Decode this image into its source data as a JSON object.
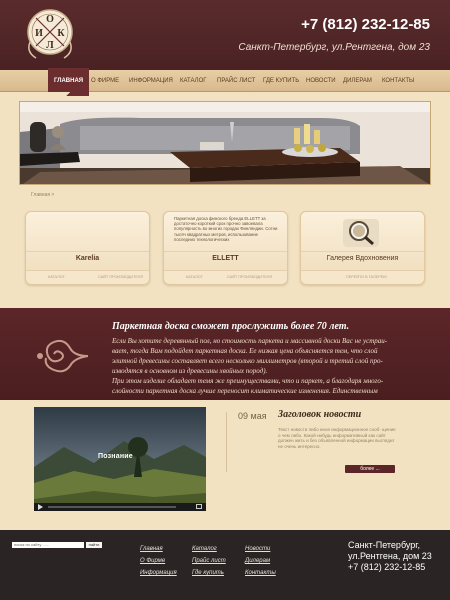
{
  "header": {
    "logo_letters": [
      "О",
      "И",
      "К",
      "Л"
    ],
    "phone": "+7 (812) 232-12-85",
    "address": "Санкт-Петербург, ул.Рентгена, дом 23"
  },
  "nav": {
    "items": [
      "Главная",
      "О фирме",
      "Информация",
      "Каталог",
      "Прайс лист",
      "Где купить",
      "Новости",
      "Дилерам",
      "Контакты"
    ]
  },
  "breadcrumb": "Главная  >",
  "cards": [
    {
      "title": "Karelia",
      "actions": [
        "Каталог",
        "Сайт производителя"
      ]
    },
    {
      "title": "ELLETT",
      "desc": "Паркетная доска финского бренда ELLETT за достаточно короткий срок прочно завоевала популярность во многих городах Финляндии. Сотни тысяч квадратных метров, использование последних технологических",
      "actions": [
        "Каталог",
        "Сайт производителя"
      ]
    },
    {
      "title": "Галерея Вдохновения",
      "actions": [
        "Перейти в галерею"
      ]
    }
  ],
  "quote": {
    "title": "Паркетная доска сможет прослужить более 70 лет.",
    "lines": [
      "Если Вы хотите деревянный пол, но стоимость паркета и массивной доски Вас не устраи-",
      "вает, тогда Вам подойдет паркетная доска. Ее низкая цена объясняется тем, что слой",
      "элитной древесины составляет всего несколько миллиметров (второй и третий слой про-",
      "изводятся в основном из древесины хвойных пород).",
      "При этом изделие обладает темя же преимуществами, что и паркет, а благодаря много-",
      "слойности паркетная доска лучше переносит климатические изменения. Единственным"
    ]
  },
  "video": {
    "caption": "Познание"
  },
  "news": {
    "date": "09 мая",
    "title": "Заголовок новости",
    "text": "Текст новости либо иное информационное сооб- щение о чем либо. Какой нибудь информативный как сайт должен жить и без объявленной информации выглядит не очень интересно.",
    "more_label": "более ..."
  },
  "footer": {
    "search_placeholder": "поиск по сайту ......",
    "search_button": "найти",
    "col1": [
      "Главная",
      "О Фирме",
      "Информация"
    ],
    "col2": [
      "Каталог",
      "Прайс лист",
      "Где купить"
    ],
    "col3": [
      "Новости",
      "Дилерам",
      "Контакты"
    ],
    "address_lines": [
      "Санкт-Петербург,",
      "ул.Рентгена, дом 23",
      "+7 (812) 232-12-85"
    ]
  },
  "colors": {
    "maroon": "#5c2628",
    "beige": "#f2e2c2",
    "footer": "#2a2424"
  }
}
